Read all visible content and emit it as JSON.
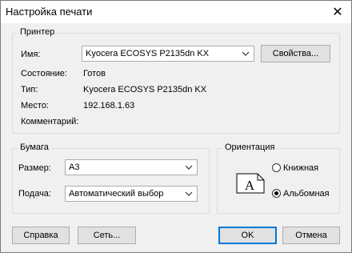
{
  "window": {
    "title": "Настройка печати",
    "close_symbol": "✕"
  },
  "printer": {
    "group_title": "Принтер",
    "name_label": "Имя:",
    "name_value": "Kyocera ECOSYS P2135dn KX",
    "properties_button": "Свойства...",
    "status_label": "Состояние:",
    "status_value": "Готов",
    "type_label": "Тип:",
    "type_value": "Kyocera ECOSYS P2135dn KX",
    "location_label": "Место:",
    "location_value": "192.168.1.63",
    "comment_label": "Комментарий:"
  },
  "paper": {
    "group_title": "Бумага",
    "size_label": "Размер:",
    "size_value": "A3",
    "source_label": "Подача:",
    "source_value": "Автоматический выбор"
  },
  "orientation": {
    "group_title": "Ориентация",
    "icon_letter": "A",
    "portrait_label": "Книжная",
    "landscape_label": "Альбомная",
    "selected": "landscape"
  },
  "buttons": {
    "help": "Справка",
    "network": "Сеть...",
    "ok": "OK",
    "cancel": "Отмена"
  },
  "colors": {
    "accent": "#0078d7",
    "background": "#f0f0f0"
  }
}
